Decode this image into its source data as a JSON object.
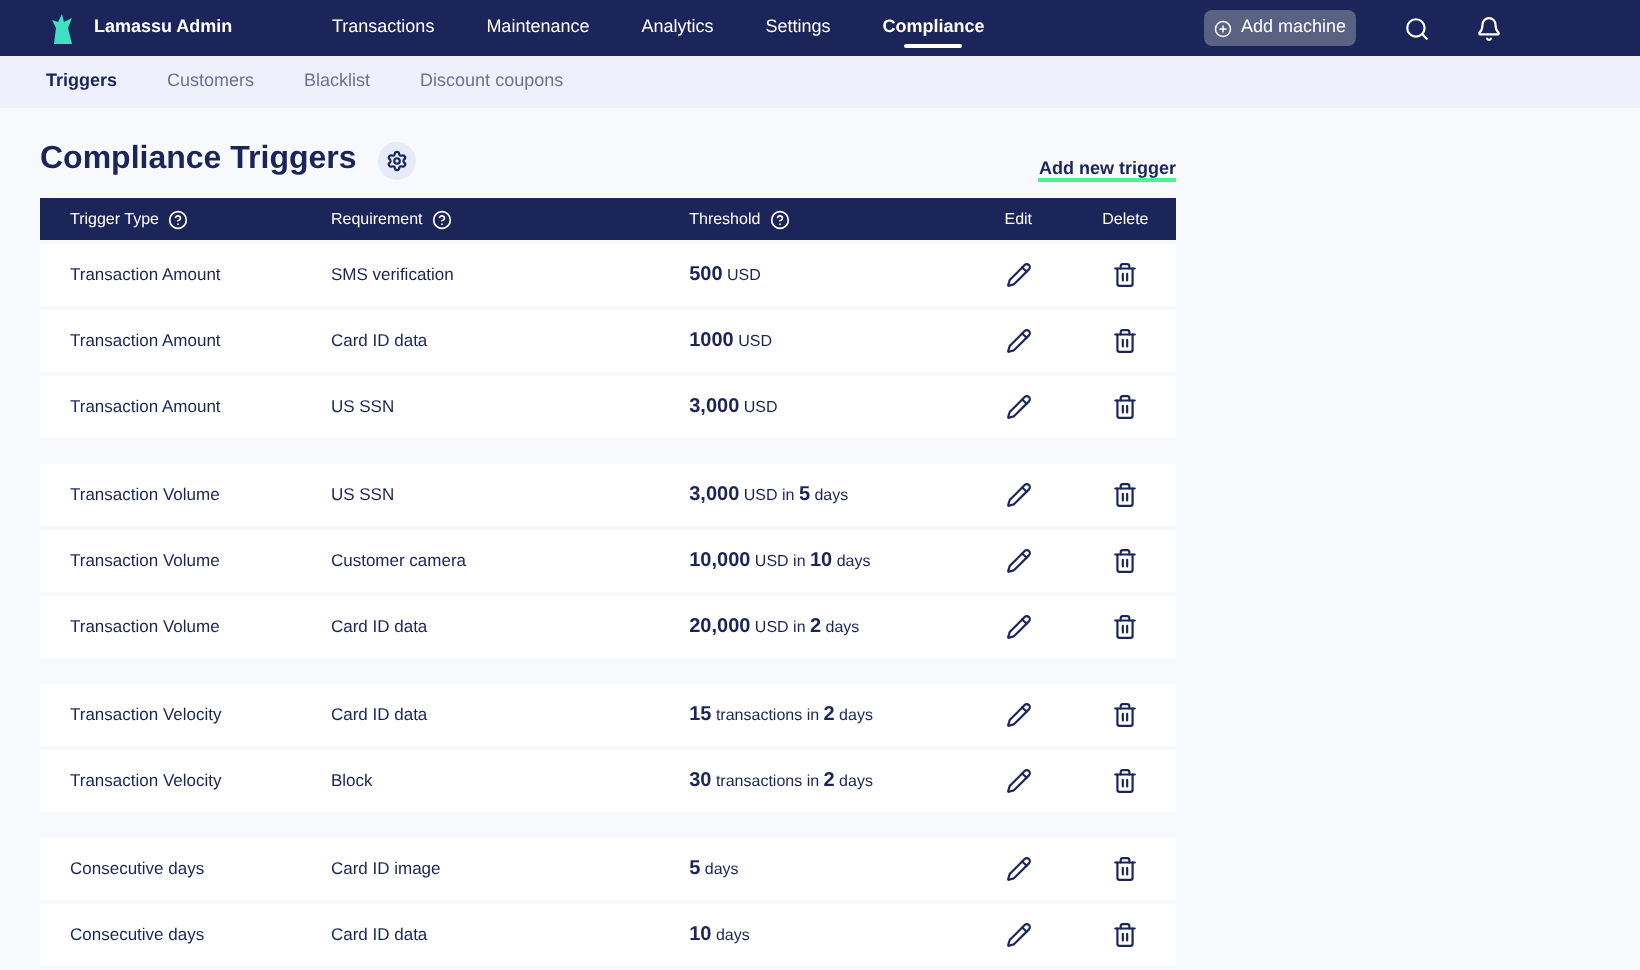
{
  "app": {
    "title": "Lamassu Admin"
  },
  "nav": [
    {
      "label": "Transactions",
      "selected": false
    },
    {
      "label": "Maintenance",
      "selected": false
    },
    {
      "label": "Analytics",
      "selected": false
    },
    {
      "label": "Settings",
      "selected": false
    },
    {
      "label": "Compliance",
      "selected": true
    }
  ],
  "add_machine": "Add machine",
  "subnav": [
    {
      "label": "Triggers",
      "selected": true
    },
    {
      "label": "Customers",
      "selected": false
    },
    {
      "label": "Blacklist",
      "selected": false
    },
    {
      "label": "Discount coupons",
      "selected": false
    }
  ],
  "page_title": "Compliance Triggers",
  "add_trigger": "Add new trigger",
  "table": {
    "columns": [
      {
        "label": "Trigger Type",
        "help": true
      },
      {
        "label": "Requirement",
        "help": true
      },
      {
        "label": "Threshold",
        "help": true
      },
      {
        "label": "Edit",
        "help": false
      },
      {
        "label": "Delete",
        "help": false
      }
    ],
    "groups": [
      [
        {
          "type": "Transaction Amount",
          "requirement": "SMS verification",
          "threshold": "**500** USD"
        },
        {
          "type": "Transaction Amount",
          "requirement": "Card ID data",
          "threshold": "**1000** USD"
        },
        {
          "type": "Transaction Amount",
          "requirement": "US SSN",
          "threshold": "**3,000** USD"
        }
      ],
      [
        {
          "type": "Transaction Volume",
          "requirement": "US SSN",
          "threshold": "**3,000** USD in **5** days"
        },
        {
          "type": "Transaction Volume",
          "requirement": "Customer camera",
          "threshold": "**10,000** USD in **10** days"
        },
        {
          "type": "Transaction Volume",
          "requirement": "Card ID data",
          "threshold": "**20,000** USD in **2** days"
        }
      ],
      [
        {
          "type": "Transaction Velocity",
          "requirement": "Card ID data",
          "threshold": "**15** transactions in **2** days"
        },
        {
          "type": "Transaction Velocity",
          "requirement": "Block",
          "threshold": "**30** transactions in **2** days"
        }
      ],
      [
        {
          "type": "Consecutive days",
          "requirement": "Card ID image",
          "threshold": "**5** days"
        },
        {
          "type": "Consecutive days",
          "requirement": "Card ID data",
          "threshold": "**10** days"
        }
      ]
    ]
  }
}
